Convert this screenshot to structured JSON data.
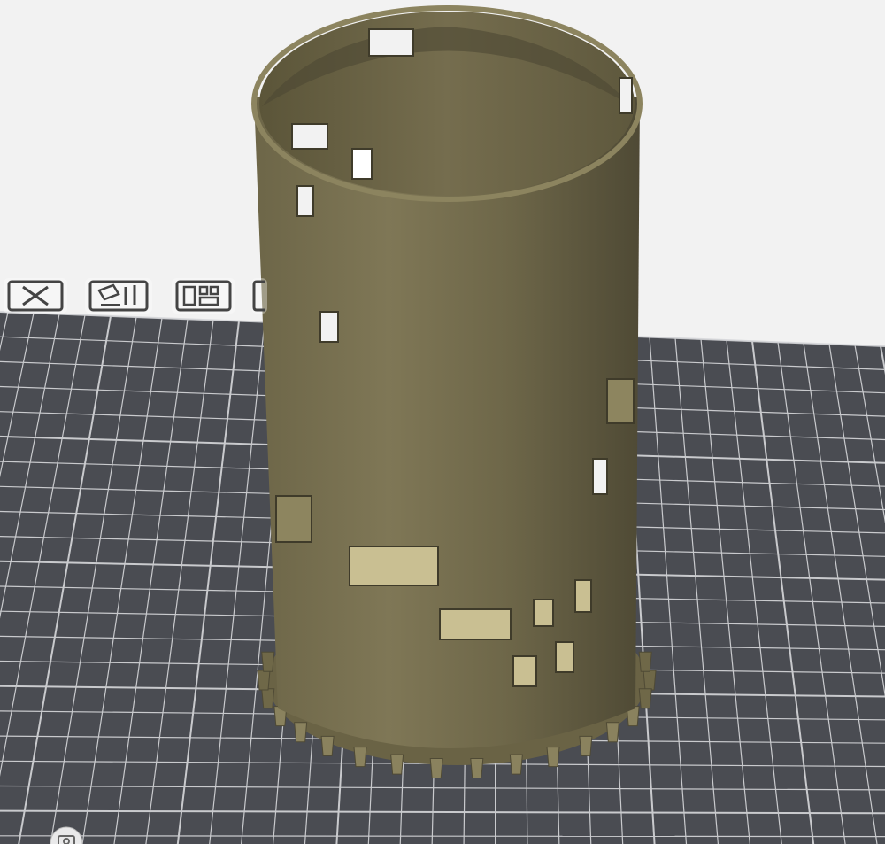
{
  "viewport": {
    "background": "#f2f2f2",
    "bed_color": "#4a4c52",
    "grid_color": "#d7d8db",
    "model_color": "#7e7655",
    "model_light": "#8a825e",
    "model_dark": "#4f4a35"
  },
  "toolbar": {
    "items": [
      {
        "name": "delete",
        "icon": "close-x-icon"
      },
      {
        "name": "lay-flat",
        "icon": "lay-flat-icon"
      },
      {
        "name": "arrange",
        "icon": "arrange-icon"
      },
      {
        "name": "more",
        "icon": "partial-icon"
      }
    ]
  },
  "model": {
    "type": "cylinder with gear teeth at base",
    "window_count": 18,
    "tooth_count": 30
  },
  "corner": {
    "icon": "camera-icon"
  }
}
